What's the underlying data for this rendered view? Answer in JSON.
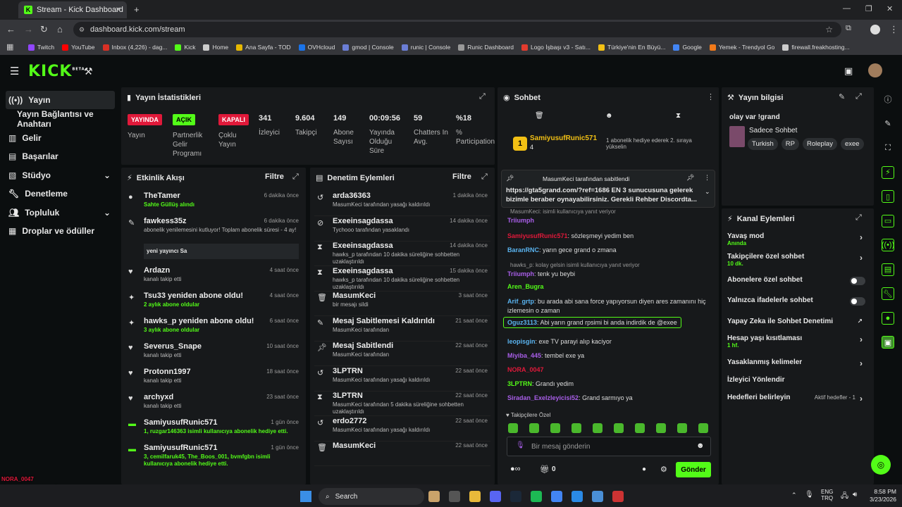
{
  "browser": {
    "tab_title": "Stream - Kick Dashboard",
    "url": "dashboard.kick.com/stream",
    "bookmarks": [
      "Twitch",
      "YouTube",
      "Inbox (4,226) - dag...",
      "Kick",
      "Home",
      "Ana Sayfa - TOD",
      "OVHcloud",
      "gmod | Console",
      "runic | Console",
      "Runic Dashboard",
      "Logo İşbaşı v3 - Satı...",
      "Türkiye'nin En Büyü...",
      "Google",
      "Yemek - Trendyol Go",
      "firewall.freakhosting..."
    ]
  },
  "app": {
    "logo": "KICK",
    "beta": "BETA"
  },
  "sidebar": {
    "items": [
      "Yayın",
      "Yayın Bağlantısı ve Anahtarı",
      "Gelir",
      "Başarılar",
      "Stüdyo",
      "Denetleme",
      "Topluluk",
      "Droplar ve ödüller"
    ]
  },
  "stats": {
    "title": "Yayın İstatistikleri",
    "tags": [
      {
        "tag": "YAYINDA",
        "label": "Yayın"
      },
      {
        "tag": "AÇIK",
        "label": "Partnerlik Gelir Programı"
      },
      {
        "tag": "KAPALI",
        "label": "Çoklu Yayın"
      }
    ],
    "values": [
      {
        "value": "341",
        "label": "İzleyici"
      },
      {
        "value": "9.604",
        "label": "Takipçi"
      },
      {
        "value": "149",
        "label": "Abone Sayısı"
      },
      {
        "value": "00:09:56",
        "label": "Yayında Olduğu Süre"
      },
      {
        "value": "59",
        "label": "Chatters In Avg."
      },
      {
        "value": "%18",
        "label": "% Participation"
      }
    ]
  },
  "activity": {
    "title": "Etkinlik Akışı",
    "filter": "Filtre",
    "items": [
      {
        "title": "TheTamer",
        "sub": "Sahte Güllüş alındı",
        "time": "6 dakika önce"
      },
      {
        "title": "fawkess35z",
        "sub": "abonelik yenilemesini kutluyor! Toplam abonelik süresi - 4 ay!",
        "time": "6 dakika önce",
        "quote": "yeni yayıncı Sa"
      },
      {
        "title": "Ardazn",
        "sub": "kanalı takip etti",
        "time": "4 saat önce"
      },
      {
        "title": "Tsu33 yeniden abone oldu!",
        "sub": "2 aylık abone oldular",
        "time": "4 saat önce"
      },
      {
        "title": "hawks_p yeniden abone oldu!",
        "sub": "3 aylık abone oldular",
        "time": "6 saat önce"
      },
      {
        "title": "Severus_Snape",
        "sub": "kanalı takip etti",
        "time": "10 saat önce"
      },
      {
        "title": "Protonn1997",
        "sub": "kanalı takip etti",
        "time": "18 saat önce"
      },
      {
        "title": "archyxd",
        "sub": "kanalı takip etti",
        "time": "23 saat önce"
      },
      {
        "title": "SamiyusufRunic571",
        "sub": "1, ruzgar146363 isimli kullanıcıya abonelik hediye etti.",
        "time": "1 gün önce"
      },
      {
        "title": "SamiyusufRunic571",
        "sub": "3, cemilfaruk45, The_Boos_001, bvmfgbn isimli kullanıcıya abonelik hediye etti.",
        "time": "1 gün önce"
      }
    ]
  },
  "moderation": {
    "title": "Denetim Eylemleri",
    "filter": "Filtre",
    "items": [
      {
        "title": "arda36363",
        "sub": "MasumKeci tarafından yasağı kaldırıldı",
        "time": "1 dakika önce"
      },
      {
        "title": "Exeeinsagdassa",
        "sub": "Tychooo tarafından yasaklandı",
        "time": "14 dakika önce"
      },
      {
        "title": "Exeeinsagdassa",
        "sub": "hawks_p tarafından 10 dakika süreliğine sohbetten uzaklaştırıldı",
        "time": "14 dakika önce"
      },
      {
        "title": "Exeeinsagdassa",
        "sub": "hawks_p tarafından 10 dakika süreliğine sohbetten uzaklaştırıldı",
        "time": "15 dakika önce"
      },
      {
        "title": "MasumKeci",
        "sub": "bir mesajı sildi",
        "time": "3 saat önce"
      },
      {
        "title": "Mesaj Sabitlemesi Kaldırıldı",
        "sub": "MasumKeci tarafından",
        "time": "21 saat önce"
      },
      {
        "title": "Mesaj Sabitlendi",
        "sub": "MasumKeci tarafından",
        "time": "22 saat önce"
      },
      {
        "title": "3LPTRN",
        "sub": "MasumKeci tarafından yasağı kaldırıldı",
        "time": "22 saat önce"
      },
      {
        "title": "3LPTRN",
        "sub": "MasumKeci tarafından 5 dakika süreliğine sohbetten uzaklaştırıldı",
        "time": "22 saat önce"
      },
      {
        "title": "erdo2772",
        "sub": "MasumKeci tarafından yasağı kaldırıldı",
        "time": "22 saat önce"
      },
      {
        "title": "MasumKeci",
        "sub": "",
        "time": "22 saat önce"
      }
    ]
  },
  "chat": {
    "title": "Sohbet",
    "top_gifter": "SamiyusufRunic571",
    "top_gifter_count": "4",
    "top_gifter_note": "1 abonelik hediye ederek 2. sıraya yükselin",
    "pinned_by": "MasumKeci tarafından sabitlendi",
    "pinned_text": "https://gta5grand.com/?ref=1686 EN 3 sunucusuna gelerek bizimle beraber oynayabilirsiniz. Gerekli Rehber Discordta...",
    "messages": [
      {
        "reply": "MasumKeci: isimli kullanıcıya yanıt veriyor",
        "name": "Triiumph",
        "text": ""
      },
      {
        "name": "SamiyusufRunic571",
        "text": "sözleşmeyi yedim ben"
      },
      {
        "name": "BaranRNC",
        "text": "yarın gece grand o zmana"
      },
      {
        "reply": "hawks_p: kolay gelsin isimli kullanıcıya yanıt veriyor",
        "name": "Triiumph",
        "text": "tenk yu beybi"
      },
      {
        "name": "Aren_Bugra",
        "text": ""
      },
      {
        "name": "Arif_grtp",
        "text": "bu arada abi sana force yapıyorsun diyen ares zamanını hiç izlemesin o zaman"
      },
      {
        "name": "Oguz3113",
        "text": "Abi yarın grand rpsimi bi anda indirdik de @exee"
      },
      {
        "name": "leopisgin",
        "text": "exe TV parayi alıp kaciyor"
      },
      {
        "name": "Miyiba_445",
        "text": "tembel exe ya"
      },
      {
        "name": "NORA_0047",
        "text": ""
      },
      {
        "name": "3LPTRN",
        "text": "Grandı yedim"
      },
      {
        "name": "Siradan_Exelzleyicisi52",
        "text": "Grand sarmıyo ya"
      }
    ],
    "followers_only": "Takipçilere Özel",
    "input_placeholder": "Bir mesaj gönderin",
    "count": "0",
    "send": "Gönder"
  },
  "stream_info": {
    "title": "Yayın bilgisi",
    "stream_title": "olay var !grand",
    "category": "Sadece Sohbet",
    "tags": [
      "Turkish",
      "RP",
      "Roleplay",
      "exee"
    ]
  },
  "channel_actions": {
    "title": "Kanal Eylemleri",
    "items": [
      {
        "label": "Yavaş mod",
        "sub": "Anında"
      },
      {
        "label": "Takipçilere özel sohbet",
        "sub": "10 dk."
      },
      {
        "label": "Abonelere özel sohbet",
        "sub": ""
      },
      {
        "label": "Yalnızca ifadelerle sohbet",
        "sub": ""
      },
      {
        "label": "Yapay Zeka ile Sohbet Denetimi",
        "sub": ""
      },
      {
        "label": "Hesap yaşı kısıtlaması",
        "sub": "1 hf."
      },
      {
        "label": "Yasaklanmış kelimeler",
        "sub": ""
      },
      {
        "label": "İzleyici Yönlendir",
        "sub": ""
      },
      {
        "label": "Hedefleri belirleyin",
        "sub": ""
      }
    ],
    "goals_active": "Aktif hedefler - 1"
  },
  "overlay_chat": [
    {
      "name": "NORA_0047",
      "text": ""
    },
    {
      "name": "3LPTRN",
      "text": "Grandı yedim"
    },
    {
      "name": "Siradan_Exelzleyicisi52",
      "text": "Grand sarmıyo ya"
    }
  ],
  "taskbar": {
    "search": "Search",
    "lang": "ENG",
    "lang2": "TRQ",
    "time": "8:58 PM",
    "date": "3/23/2026"
  },
  "colors": {
    "kick_green": "#53fc18",
    "live_red": "#e0193a",
    "panel": "#17191b"
  }
}
